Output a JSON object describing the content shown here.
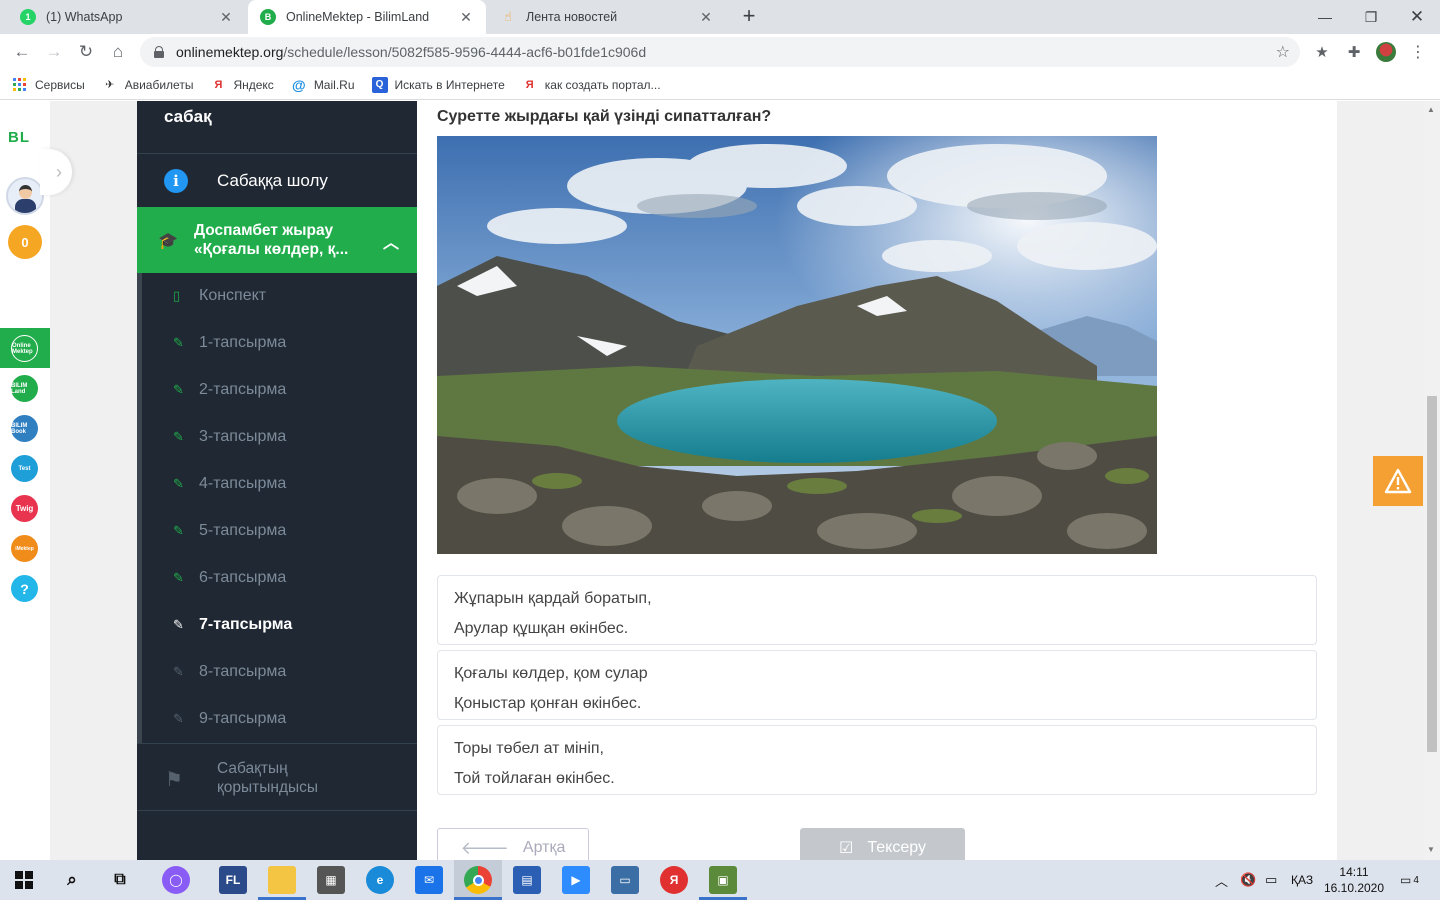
{
  "browser": {
    "tabs": [
      {
        "title": "(1) WhatsApp",
        "favicon_text": "1",
        "color": "#25d366"
      },
      {
        "title": "OnlineMektep - BilimLand",
        "favicon_text": "B",
        "color": "#21ad4b"
      },
      {
        "title": "Лента новостей",
        "favicon_text": "",
        "color": "#f0a030"
      }
    ],
    "url_host": "onlinemektep.org",
    "url_path": "/schedule/lesson/5082f585-9596-4444-acf6-b01fde1c906d",
    "bookmarks": [
      {
        "label": "Сервисы",
        "icon": "apps-grid-icon"
      },
      {
        "label": "Авиабилеты",
        "icon": "plane-icon"
      },
      {
        "label": "Яндекс",
        "icon": "yandex-icon"
      },
      {
        "label": "Mail.Ru",
        "icon": "mailru-icon"
      },
      {
        "label": "Искать в Интернете",
        "icon": "search-icon"
      },
      {
        "label": "как создать портал...",
        "icon": "yandex-icon"
      }
    ]
  },
  "leftbar": {
    "logo": "BL",
    "coins": "0",
    "apps": [
      {
        "name": "onlinemektep",
        "color": "#21ad4b",
        "text": "Online Mektep"
      },
      {
        "name": "bilimland",
        "color": "#21ad4b",
        "text": "BILIM Land"
      },
      {
        "name": "bilimbook",
        "color": "#2f7fc1",
        "text": "BILIM Book"
      },
      {
        "name": "test",
        "color": "#1e9fd8",
        "text": "Test"
      },
      {
        "name": "twig",
        "color": "#e8344e",
        "text": "Twig"
      },
      {
        "name": "imektep",
        "color": "#f08c1a",
        "text": "iMektep"
      },
      {
        "name": "help",
        "color": "#22b7e8",
        "text": "?"
      }
    ]
  },
  "lesson": {
    "header_partial": "сабақ",
    "overview": "Сабаққа шолу",
    "topic_line1": "Доспамбет жырау",
    "topic_line2": "«Қоғалы көлдер, қ...",
    "items": [
      {
        "label": "Конспект",
        "state": "done"
      },
      {
        "label": "1-тапсырма",
        "state": "done"
      },
      {
        "label": "2-тапсырма",
        "state": "done"
      },
      {
        "label": "3-тапсырма",
        "state": "done"
      },
      {
        "label": "4-тапсырма",
        "state": "done"
      },
      {
        "label": "5-тапсырма",
        "state": "done"
      },
      {
        "label": "6-тапсырма",
        "state": "done"
      },
      {
        "label": "7-тапсырма",
        "state": "current"
      },
      {
        "label": "8-тапсырма",
        "state": "todo"
      },
      {
        "label": "9-тапсырма",
        "state": "todo"
      }
    ],
    "summary_line1": "Сабақтың",
    "summary_line2": "қорытындысы"
  },
  "task": {
    "question": "Суретте жырдағы қай үзінді сипатталған?",
    "options": [
      {
        "line1": "Жұпарын қардай боратып,",
        "line2": "Арулар құшқан өкінбес."
      },
      {
        "line1": "Қоғалы көлдер, қом сулар",
        "line2": "Қоныстар қонған өкінбес."
      },
      {
        "line1": "Торы төбел ат мініп,",
        "line2": "Той тойлаған өкінбес."
      }
    ],
    "back_label": "Артқа",
    "check_label": "Тексеру"
  },
  "taskbar": {
    "lang": "ҚАЗ",
    "time": "14:11",
    "date": "16.10.2020",
    "notifications": "4"
  }
}
